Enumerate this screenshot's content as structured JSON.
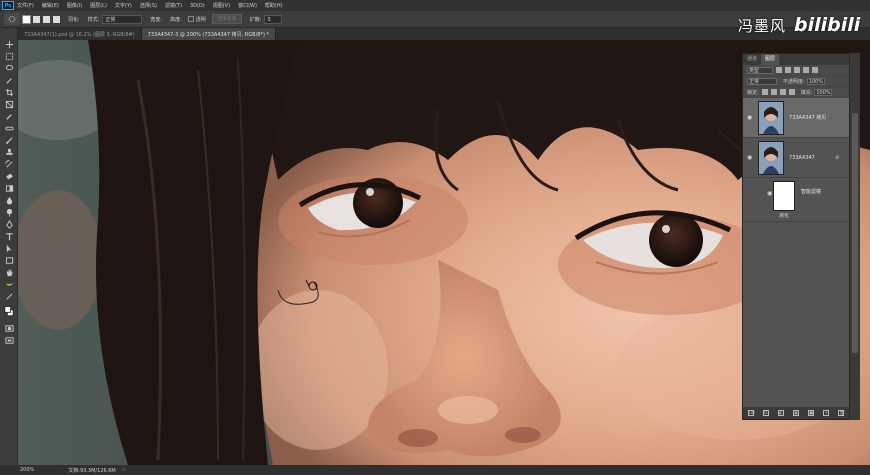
{
  "menubar": {
    "logo": "Ps",
    "items": [
      "文件(F)",
      "编辑(E)",
      "图像(I)",
      "图层(L)",
      "文字(Y)",
      "选择(S)",
      "滤镜(T)",
      "3D(D)",
      "视图(V)",
      "窗口(W)",
      "帮助(H)"
    ]
  },
  "optionsbar": {
    "feather_label": "羽化:",
    "mode_label": "样式:",
    "mode_value": "正常",
    "width_label": "宽度:",
    "height_label": "高度:",
    "transparent_label": "透明",
    "select_subject": "选择主体",
    "tolerance_label": "扩散:",
    "tolerance_value": "5"
  },
  "tabs": [
    {
      "label": "733A4347(1).psd @ 16.2% (图层 3, RGB/8#)",
      "active": false
    },
    {
      "label": "733A4347-3 @ 200% (733A4347 拷贝, RGB/8*) *",
      "active": true
    }
  ],
  "watermark": {
    "name": "冯墨风",
    "logo": "bilibili"
  },
  "status": {
    "zoom": "200%",
    "docinfo": "文档:93.3M/126.6M",
    "arrow": ">"
  },
  "panel": {
    "tabs": [
      "通道",
      "图层"
    ],
    "kind_value": "类型",
    "blend_value": "正常",
    "opacity_label": "不透明度:",
    "opacity_value": "100%",
    "lock_label": "锁定:",
    "fill_label": "填充:",
    "fill_value": "100%",
    "layers": [
      {
        "name": "733A4347 拷贝",
        "selected": true
      },
      {
        "name": "733A4347",
        "selected": false
      }
    ],
    "smart_filters_label": "智能滤镜",
    "filter_name": "液化",
    "bottom_icons": [
      "GO",
      "fx",
      "◐",
      "▣",
      "■",
      "+",
      "🗑"
    ]
  },
  "colors": {
    "menubar": "#323232",
    "panel": "#535353",
    "selected_layer": "#686868",
    "accent": "#31a8ff"
  }
}
